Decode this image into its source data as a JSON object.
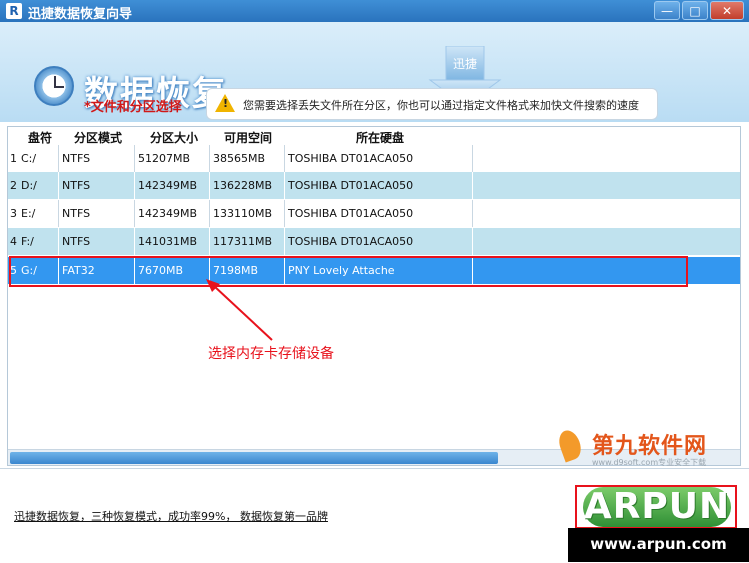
{
  "window": {
    "title": "迅捷数据恢复向导",
    "app_icon": "R",
    "minimize_label": "—",
    "maximize_label": "□",
    "close_label": "✕"
  },
  "header": {
    "title": "数据恢复",
    "badge_text": "迅捷",
    "step_label": "*文件和分区选择",
    "hint": "您需要选择丢失文件所在分区，你也可以通过指定文件格式来加快文件搜索的速度",
    "hint_icon_glyph": "!"
  },
  "table": {
    "columns": [
      "盘符",
      "分区模式",
      "分区大小",
      "可用空间",
      "所在硬盘"
    ],
    "rows": [
      {
        "index": "1",
        "drive": "C:/",
        "mode": "NTFS",
        "size": "51207MB",
        "free": "38565MB",
        "disk": "TOSHIBA DT01ACA050"
      },
      {
        "index": "2",
        "drive": "D:/",
        "mode": "NTFS",
        "size": "142349MB",
        "free": "136228MB",
        "disk": "TOSHIBA DT01ACA050"
      },
      {
        "index": "3",
        "drive": "E:/",
        "mode": "NTFS",
        "size": "142349MB",
        "free": "133110MB",
        "disk": "TOSHIBA DT01ACA050"
      },
      {
        "index": "4",
        "drive": "F:/",
        "mode": "NTFS",
        "size": "141031MB",
        "free": "117311MB",
        "disk": "TOSHIBA DT01ACA050"
      },
      {
        "index": "5",
        "drive": "G:/",
        "mode": "FAT32",
        "size": "7670MB",
        "free": "7198MB",
        "disk": "PNY Lovely Attache"
      }
    ],
    "selected_index": 4
  },
  "annotation": {
    "text": "选择内存卡存储设备",
    "color": "#e8121c"
  },
  "footer": {
    "link_text": "迅捷数据恢复，三种恢复模式，成功率99%， 数据恢复第一品牌"
  },
  "watermark": {
    "title": "第九软件网",
    "subtitle": "www.d9soft.com专业安全下载"
  },
  "arpun": {
    "logo": "ARPUN",
    "url": "www.arpun.com"
  },
  "colors": {
    "title_bar": "#2a73bd",
    "row_alt": "#c0e2ee",
    "row_selected": "#3397f0",
    "highlight_red": "#e8121c"
  }
}
